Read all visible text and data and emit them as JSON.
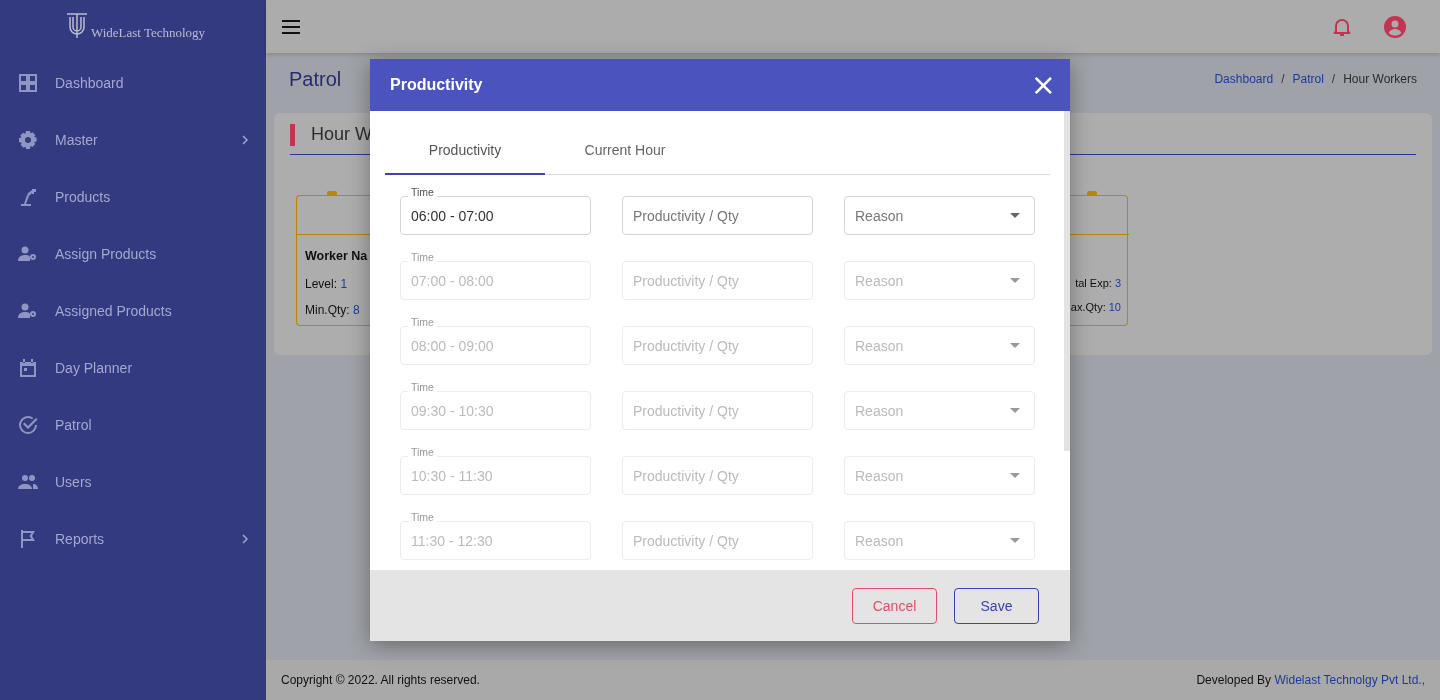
{
  "sidebar": {
    "logo": "WideLast Technology",
    "items": [
      {
        "label": "Dashboard",
        "kind": "grid",
        "has_submenu": false
      },
      {
        "label": "Master",
        "kind": "gear",
        "has_submenu": true
      },
      {
        "label": "Products",
        "kind": "robot",
        "has_submenu": false
      },
      {
        "label": "Assign Products",
        "kind": "people-gear",
        "has_submenu": false
      },
      {
        "label": "Assigned Products",
        "kind": "people-gear",
        "has_submenu": false
      },
      {
        "label": "Day Planner",
        "kind": "calendar",
        "has_submenu": false
      },
      {
        "label": "Patrol",
        "kind": "check",
        "has_submenu": false
      },
      {
        "label": "Users",
        "kind": "people",
        "has_submenu": false
      },
      {
        "label": "Reports",
        "kind": "flag",
        "has_submenu": true
      }
    ]
  },
  "page": {
    "title": "Patrol",
    "breadcrumb": [
      {
        "label": "Dashboard",
        "link": true
      },
      {
        "label": "Patrol",
        "link": true,
        "separator": "/"
      },
      {
        "label": "Hour Workers",
        "link": false,
        "separator": "/"
      }
    ],
    "card": {
      "title": "Hour W",
      "left_worker": {
        "name": "Worker Na",
        "fields": [
          {
            "label": "Level:",
            "value": "1"
          },
          {
            "label": "Min.Qty:",
            "value": "8"
          }
        ]
      },
      "right_worker": {
        "fields": [
          {
            "label": "tal Exp:",
            "value": "3"
          },
          {
            "label": "ax.Qty:",
            "value": "10"
          }
        ]
      }
    }
  },
  "footer": {
    "copyright": "Copyright © 2022. All rights reserved.",
    "developed_by": "Developed By",
    "company": "Widelast Technolgy Pvt Ltd.,"
  },
  "modal": {
    "title": "Productivity",
    "close": "×",
    "tabs": [
      {
        "label": "Productivity",
        "selected": true
      },
      {
        "label": "Current Hour",
        "selected": false
      }
    ],
    "rows": [
      {
        "time_label": "Time",
        "time": "06:00 - 07:00",
        "qty_placeholder": "Productivity / Qty",
        "reason_placeholder": "Reason",
        "disabled": false
      },
      {
        "time_label": "Time",
        "time": "07:00 - 08:00",
        "qty_placeholder": "Productivity / Qty",
        "reason_placeholder": "Reason",
        "disabled": true
      },
      {
        "time_label": "Time",
        "time": "08:00 - 09:00",
        "qty_placeholder": "Productivity / Qty",
        "reason_placeholder": "Reason",
        "disabled": true
      },
      {
        "time_label": "Time",
        "time": "09:30 - 10:30",
        "qty_placeholder": "Productivity / Qty",
        "reason_placeholder": "Reason",
        "disabled": true
      },
      {
        "time_label": "Time",
        "time": "10:30 - 11:30",
        "qty_placeholder": "Productivity / Qty",
        "reason_placeholder": "Reason",
        "disabled": true
      },
      {
        "time_label": "Time",
        "time": "11:30 - 12:30",
        "qty_placeholder": "Productivity / Qty",
        "reason_placeholder": "Reason",
        "disabled": true
      }
    ],
    "buttons": [
      {
        "label": "Cancel",
        "kind": "cancel"
      },
      {
        "label": "Save",
        "kind": "save"
      }
    ]
  }
}
